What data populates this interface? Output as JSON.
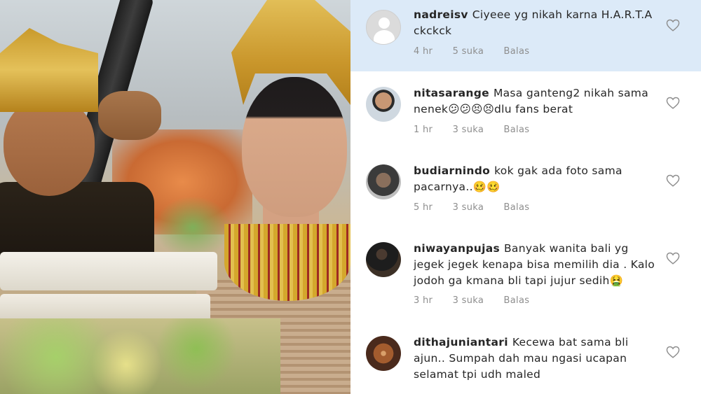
{
  "comments": [
    {
      "username": "nadreisv",
      "text": "Ciyeee yg nikah karna H.A.R.T.A ckckck",
      "time": "4 hr",
      "likes": "5 suka",
      "reply": "Balas",
      "avatar": "default-avatar-icon"
    },
    {
      "username": "nitasarange",
      "text": "Masa ganteng2 nikah sama nenek😕😕😣😣dlu fans berat",
      "time": "1 hr",
      "likes": "3 suka",
      "reply": "Balas"
    },
    {
      "username": "budiarnindo",
      "text": "kok gak ada foto sama pacarnya..🥴🥴",
      "time": "5 hr",
      "likes": "3 suka",
      "reply": "Balas"
    },
    {
      "username": "niwayanpujas",
      "text": "Banyak wanita bali yg jegek jegek kenapa bisa memilih dia . Kalo jodoh ga kmana bli tapi jujur sedih🤮",
      "time": "3 hr",
      "likes": "3 suka",
      "reply": "Balas"
    },
    {
      "username": "dithajuniantari",
      "text": "Kecewa bat sama bli ajun.. Sumpah dah mau ngasi ucapan selamat tpi udh maled",
      "time": "",
      "likes": "",
      "reply": ""
    }
  ],
  "colors": {
    "highlight": "#dceaf8",
    "text": "#262626",
    "meta": "#8e8e8e"
  }
}
